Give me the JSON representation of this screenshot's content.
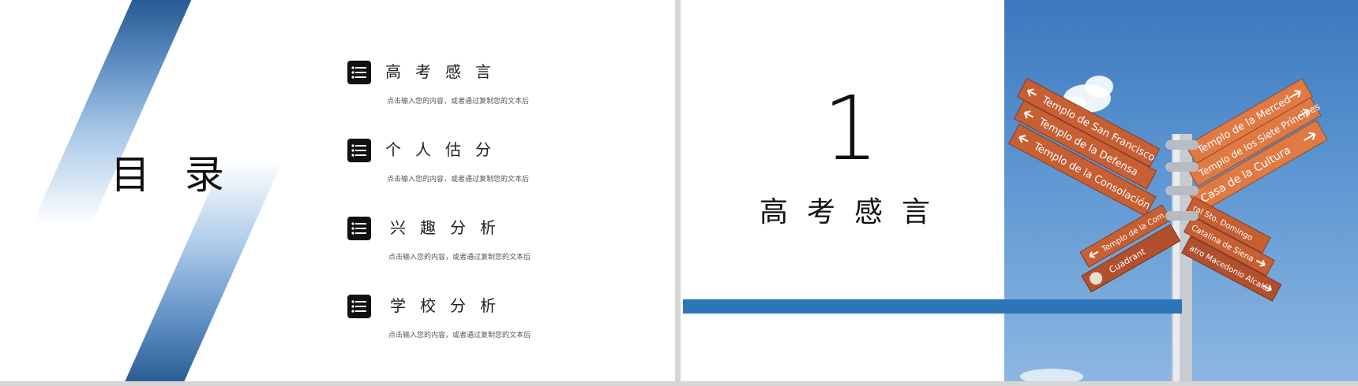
{
  "toc_slide": {
    "title": "目 录",
    "items": [
      {
        "label": "高考感言",
        "desc": "点击输入您的内容，或者通过复制您的文本后"
      },
      {
        "label": "个人估分",
        "desc": "点击输入您的内容，或者通过复制您的文本后"
      },
      {
        "label": "兴趣分析",
        "desc": "点击输入您的内容，或者通过复制您的文本后"
      },
      {
        "label": "学校分析",
        "desc": "点击输入您的内容，或者通过复制您的文本后"
      }
    ],
    "icon": "list-icon"
  },
  "section_slide": {
    "number": "1",
    "title": "高考感言",
    "signs": [
      "Templo de San Francisco",
      "Templo de la Defensa",
      "Templo de la Consolación",
      "Templo de la Merced",
      "Templo de los Siete Príncipes",
      "Casa de la Cultura",
      "Templo de la Com",
      "Cuadrant",
      "ral Sto. Domingo",
      "Catalina de Siena",
      "atro Macedonio Alcalá"
    ],
    "colors": {
      "accent": "#2e74b8",
      "sign": "#c75f34",
      "sky": "#4a86c8"
    }
  }
}
